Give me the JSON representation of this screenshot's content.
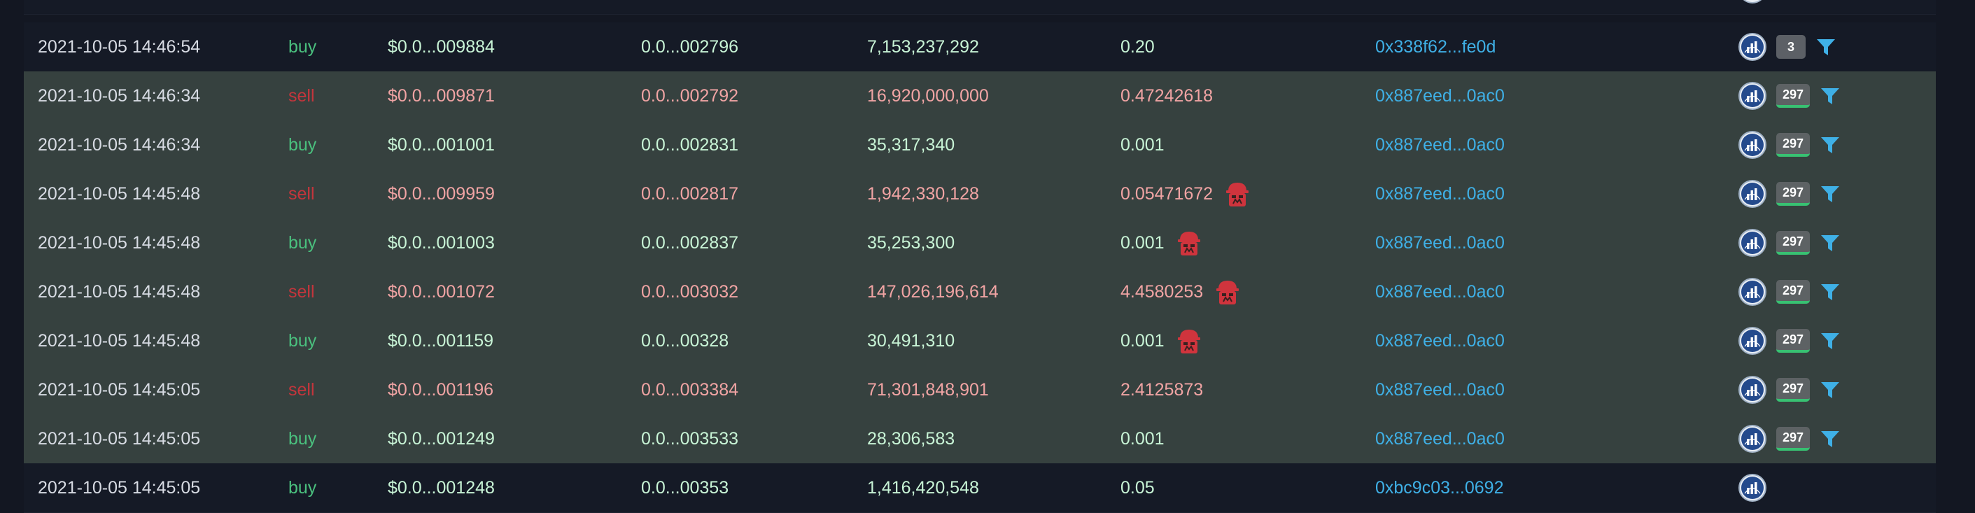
{
  "colors": {
    "buy": "#4ac07e",
    "sell": "#c4353c",
    "buy_value": "#c8f4d6",
    "sell_value": "#f1a4a4",
    "maker_link": "#3fb0e6",
    "filter_icon": "#3fb0e6",
    "bot_icon": "#d0343d"
  },
  "trades": [
    {
      "date": "2021-10-05 14:46:54",
      "type": "buy",
      "price": "$0.0...009884",
      "base": "0.0...002796",
      "amount": "7,153,237,292",
      "quote": "0.20",
      "bot": false,
      "maker": "0x338f62...fe0d",
      "tx_count": "3",
      "count_style": "plain",
      "chart_icon": "chart-icon",
      "filter_icon": "filter-icon"
    },
    {
      "date": "2021-10-05 14:46:34",
      "type": "sell",
      "price": "$0.0...009871",
      "base": "0.0...002792",
      "amount": "16,920,000,000",
      "quote": "0.47242618",
      "bot": false,
      "maker": "0x887eed...0ac0",
      "tx_count": "297",
      "count_style": "underlined",
      "chart_icon": "chart-icon",
      "filter_icon": "filter-icon"
    },
    {
      "date": "2021-10-05 14:46:34",
      "type": "buy",
      "price": "$0.0...001001",
      "base": "0.0...002831",
      "amount": "35,317,340",
      "quote": "0.001",
      "bot": false,
      "maker": "0x887eed...0ac0",
      "tx_count": "297",
      "count_style": "underlined",
      "chart_icon": "chart-icon",
      "filter_icon": "filter-icon"
    },
    {
      "date": "2021-10-05 14:45:48",
      "type": "sell",
      "price": "$0.0...009959",
      "base": "0.0...002817",
      "amount": "1,942,330,128",
      "quote": "0.05471672",
      "bot": true,
      "maker": "0x887eed...0ac0",
      "tx_count": "297",
      "count_style": "underlined",
      "chart_icon": "chart-icon",
      "filter_icon": "filter-icon"
    },
    {
      "date": "2021-10-05 14:45:48",
      "type": "buy",
      "price": "$0.0...001003",
      "base": "0.0...002837",
      "amount": "35,253,300",
      "quote": "0.001",
      "bot": true,
      "maker": "0x887eed...0ac0",
      "tx_count": "297",
      "count_style": "underlined",
      "chart_icon": "chart-icon",
      "filter_icon": "filter-icon"
    },
    {
      "date": "2021-10-05 14:45:48",
      "type": "sell",
      "price": "$0.0...001072",
      "base": "0.0...003032",
      "amount": "147,026,196,614",
      "quote": "4.4580253",
      "bot": true,
      "maker": "0x887eed...0ac0",
      "tx_count": "297",
      "count_style": "underlined",
      "chart_icon": "chart-icon",
      "filter_icon": "filter-icon"
    },
    {
      "date": "2021-10-05 14:45:48",
      "type": "buy",
      "price": "$0.0...001159",
      "base": "0.0...00328",
      "amount": "30,491,310",
      "quote": "0.001",
      "bot": true,
      "maker": "0x887eed...0ac0",
      "tx_count": "297",
      "count_style": "underlined",
      "chart_icon": "chart-icon",
      "filter_icon": "filter-icon"
    },
    {
      "date": "2021-10-05 14:45:05",
      "type": "sell",
      "price": "$0.0...001196",
      "base": "0.0...003384",
      "amount": "71,301,848,901",
      "quote": "2.4125873",
      "bot": false,
      "maker": "0x887eed...0ac0",
      "tx_count": "297",
      "count_style": "underlined",
      "chart_icon": "chart-icon",
      "filter_icon": "filter-icon"
    },
    {
      "date": "2021-10-05 14:45:05",
      "type": "buy",
      "price": "$0.0...001249",
      "base": "0.0...003533",
      "amount": "28,306,583",
      "quote": "0.001",
      "bot": false,
      "maker": "0x887eed...0ac0",
      "tx_count": "297",
      "count_style": "underlined",
      "chart_icon": "chart-icon",
      "filter_icon": "filter-icon"
    },
    {
      "date": "2021-10-05 14:45:05",
      "type": "buy",
      "price": "$0.0...001248",
      "base": "0.0...00353",
      "amount": "1,416,420,548",
      "quote": "0.05",
      "bot": false,
      "maker": "0xbc9c03...0692",
      "tx_count": "",
      "count_style": "none",
      "chart_icon": "chart-icon",
      "filter_icon": ""
    }
  ]
}
